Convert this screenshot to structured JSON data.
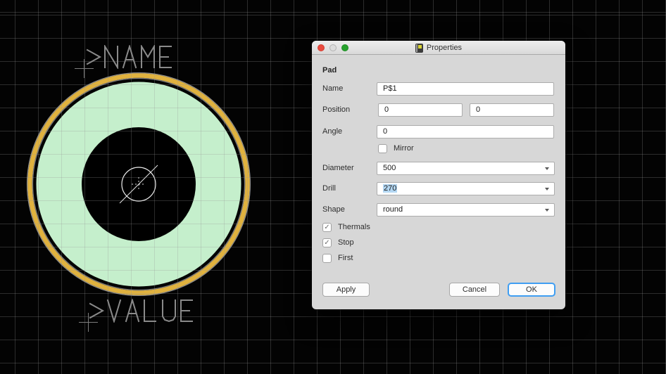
{
  "canvas": {
    "name_text": ">NAME",
    "value_text": ">VALUE",
    "text_color": "#8a8a8a"
  },
  "pad_graphic": {
    "copper_ring_color": "#e0b23f",
    "pad_fill_color": "#c5efcc",
    "hole_color": "#000000"
  },
  "window": {
    "title": "Properties",
    "section_label": "Pad",
    "rows": {
      "name": {
        "label": "Name",
        "value": "P$1"
      },
      "position": {
        "label": "Position",
        "x": "0",
        "y": "0"
      },
      "angle": {
        "label": "Angle",
        "value": "0"
      },
      "mirror": {
        "label": "Mirror",
        "checked": false
      },
      "diameter": {
        "label": "Diameter",
        "value": "500"
      },
      "drill": {
        "label": "Drill",
        "value": "270",
        "text_selected": true
      },
      "shape": {
        "label": "Shape",
        "value": "round"
      },
      "thermals": {
        "label": "Thermals",
        "checked": true
      },
      "stop": {
        "label": "Stop",
        "checked": true
      },
      "first": {
        "label": "First",
        "checked": false
      }
    },
    "buttons": {
      "apply": "Apply",
      "cancel": "Cancel",
      "ok": "OK"
    },
    "colors": {
      "ok_focus_ring": "#3f9ef2",
      "text_selection": "#b3d7f3"
    }
  }
}
